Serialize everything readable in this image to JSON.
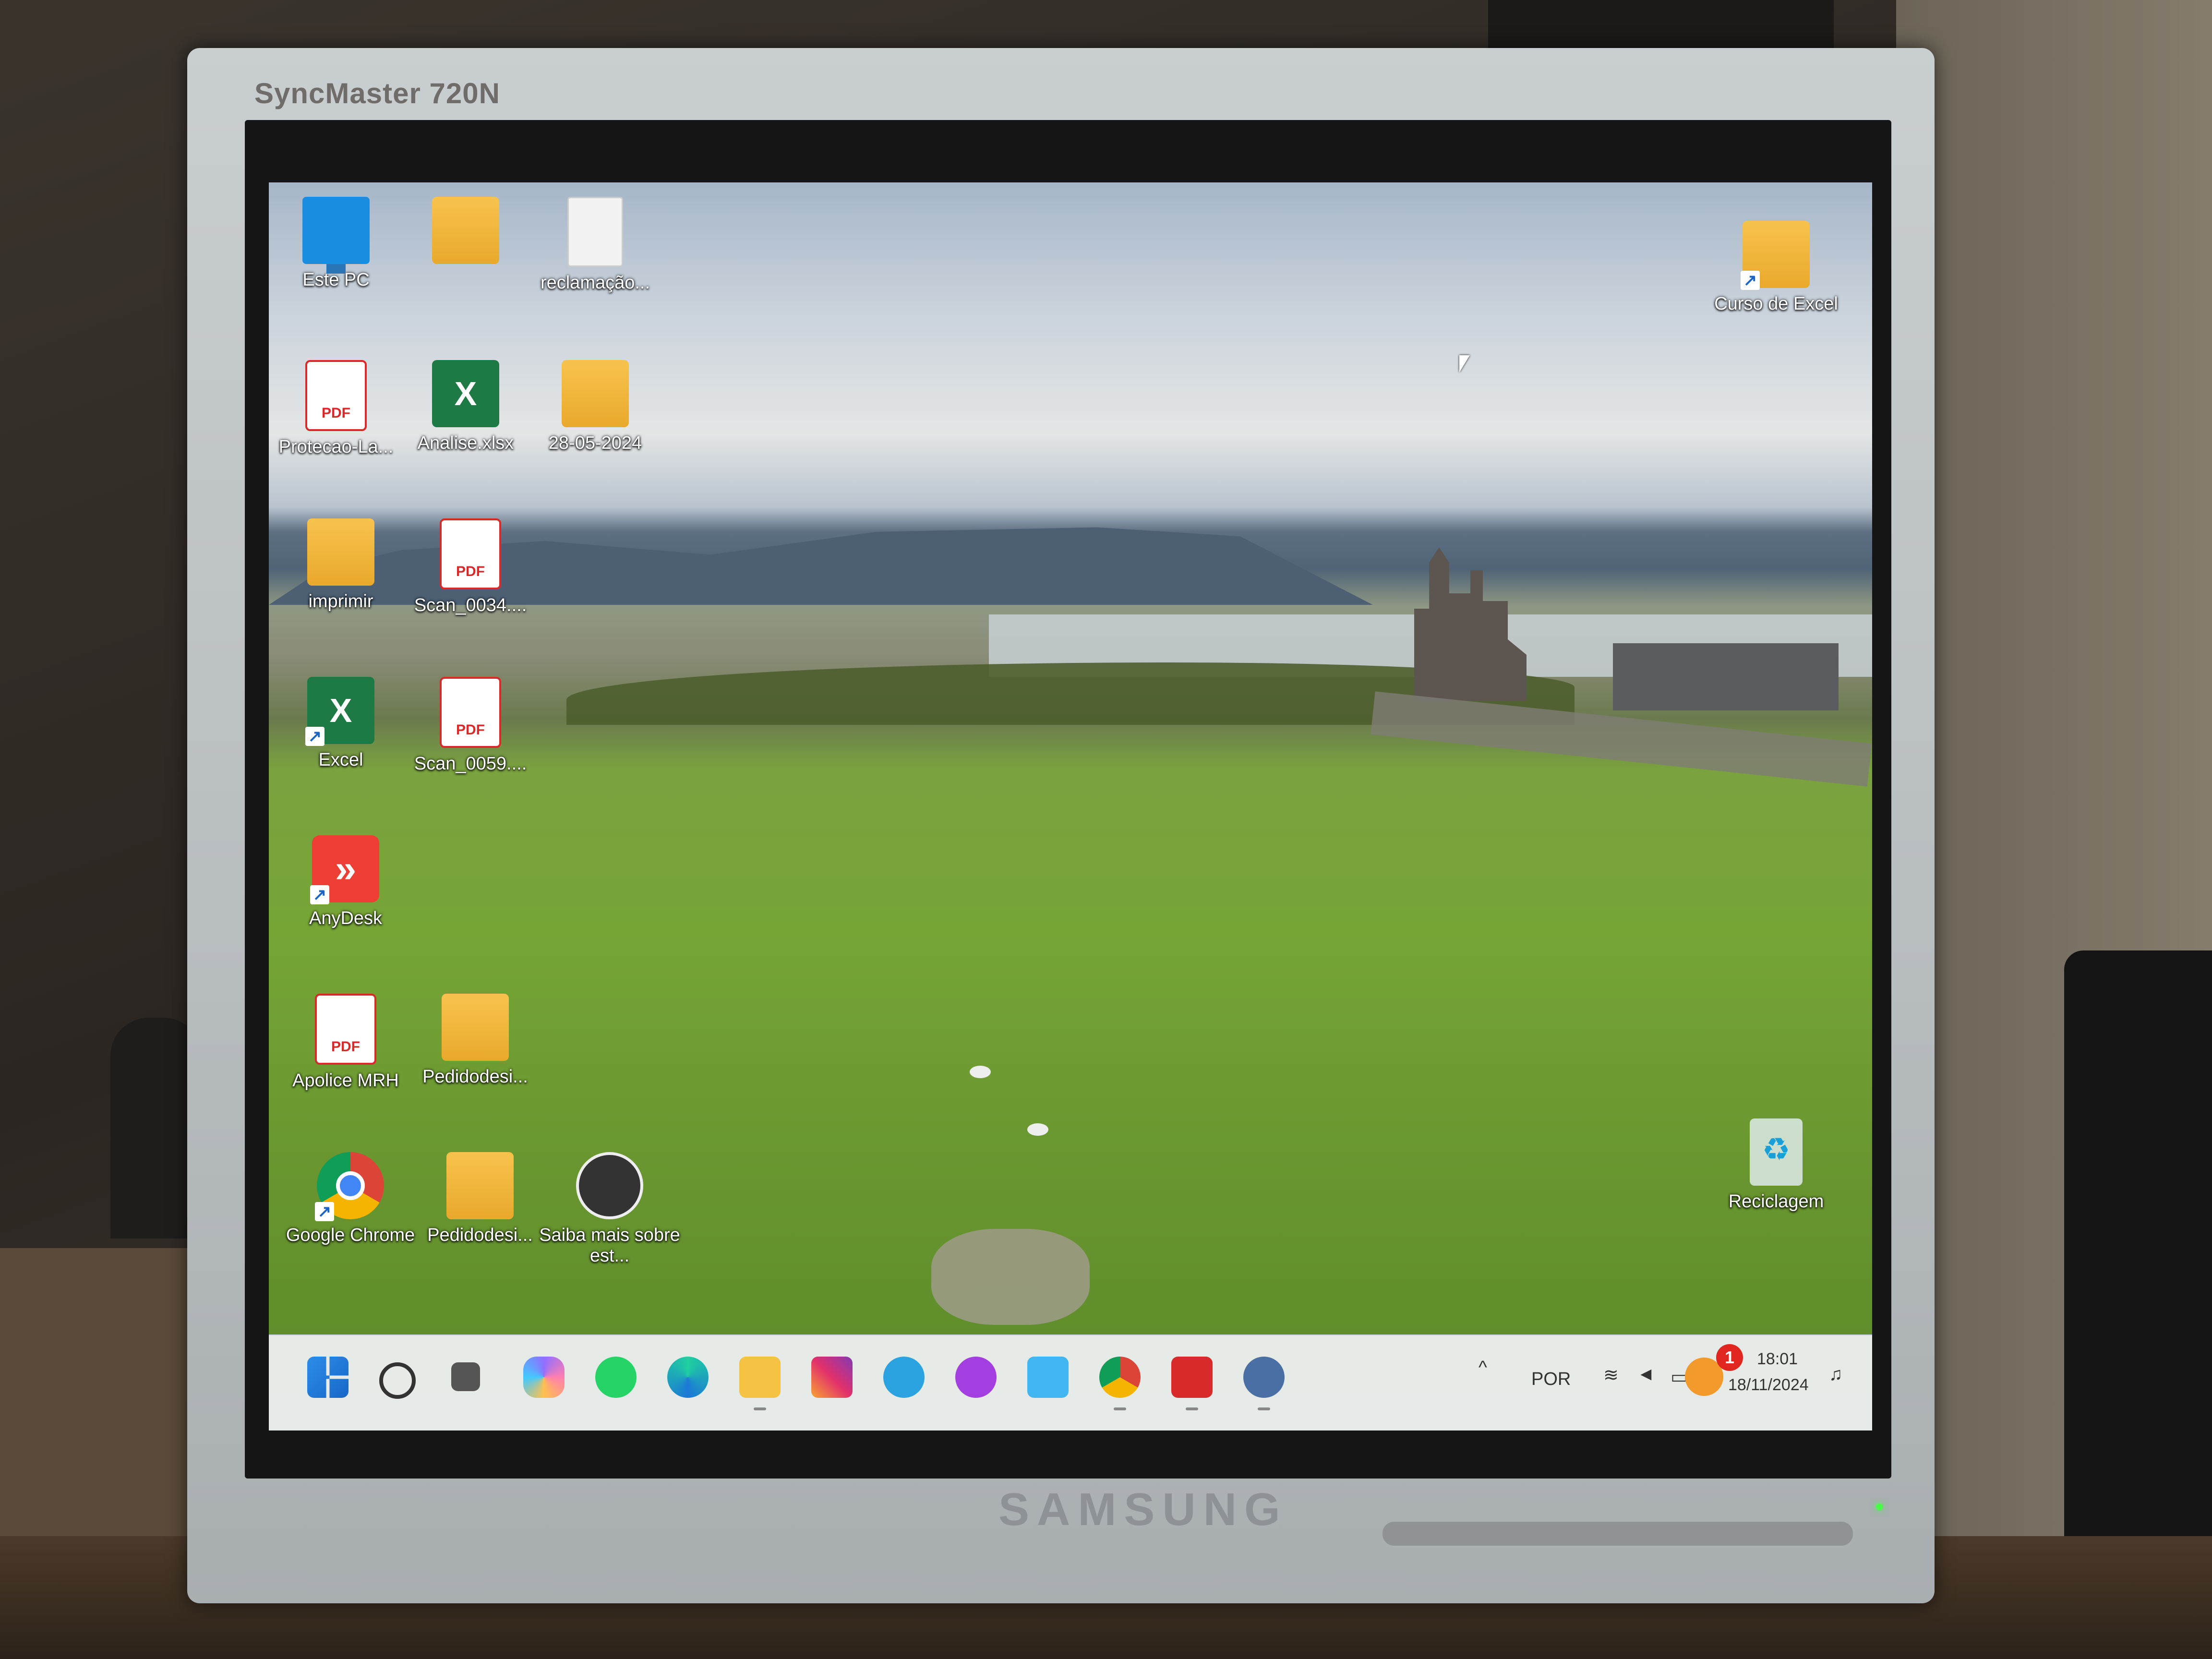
{
  "monitor": {
    "model_label": "SyncMaster 720N",
    "brand_label": "SAMSUNG"
  },
  "desktop": {
    "icons_left": [
      {
        "label": "Este PC",
        "icon": "this-pc-monitor-icon"
      },
      {
        "label": "",
        "icon": "user-folder-icon"
      },
      {
        "label": "reclamação...",
        "icon": "document-icon"
      },
      {
        "label": "Protecao-La...",
        "icon": "pdf-icon"
      },
      {
        "label": "Analise.xlsx",
        "icon": "excel-file-icon"
      },
      {
        "label": "28-05-2024",
        "icon": "folder-icon"
      },
      {
        "label": "imprimir",
        "icon": "folder-icon"
      },
      {
        "label": "Scan_0034....",
        "icon": "pdf-icon"
      },
      {
        "label": "Excel",
        "icon": "excel-app-icon"
      },
      {
        "label": "Scan_0059....",
        "icon": "pdf-icon"
      },
      {
        "label": "AnyDesk",
        "icon": "anydesk-icon"
      },
      {
        "label": "Apolice MRH",
        "icon": "pdf-icon"
      },
      {
        "label": "Pedidodesi...",
        "icon": "folder-icon"
      },
      {
        "label": "Google Chrome",
        "icon": "chrome-icon"
      },
      {
        "label": "Pedidodesi...",
        "icon": "folder-icon"
      },
      {
        "label": "Saiba mais sobre est...",
        "icon": "learn-more-icon"
      }
    ],
    "icons_right": [
      {
        "label": "Curso de Excel",
        "icon": "folder-shortcut-icon"
      },
      {
        "label": "Reciclagem",
        "icon": "recycle-bin-icon"
      }
    ]
  },
  "taskbar": {
    "apps": [
      "start-icon",
      "search-icon",
      "task-view-icon",
      "copilot-icon",
      "whatsapp-icon",
      "edge-icon",
      "file-explorer-icon",
      "instagram-icon",
      "telegram-icon",
      "messenger-icon",
      "notepad-icon",
      "chrome-icon",
      "acrobat-icon",
      "settings-icon"
    ],
    "notification_badge": "1",
    "language": "POR",
    "time": "18:01",
    "date": "18/11/2024"
  }
}
